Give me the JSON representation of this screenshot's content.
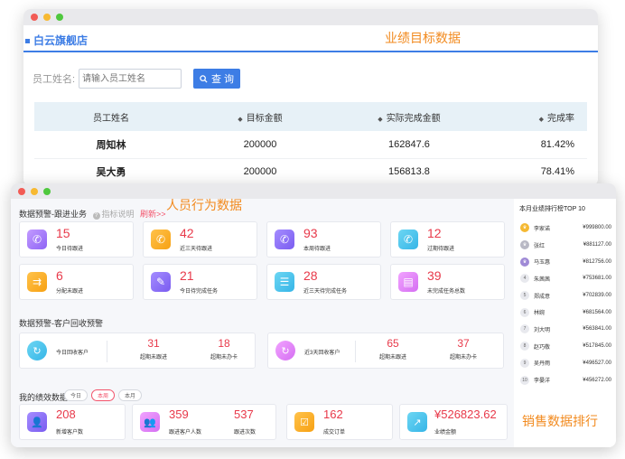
{
  "window1": {
    "store_name": "白云旗舰店",
    "callout": "业绩目标数据",
    "search": {
      "label": "员工姓名:",
      "placeholder": "请输入员工姓名",
      "button": "查 询"
    },
    "table": {
      "headers": [
        "员工姓名",
        "目标金额",
        "实际完成金额",
        "完成率"
      ],
      "rows": [
        {
          "name": "周知林",
          "target": "200000",
          "actual": "162847.6",
          "rate": "81.42%"
        },
        {
          "name": "吴大勇",
          "target": "200000",
          "actual": "156813.8",
          "rate": "78.41%"
        }
      ]
    }
  },
  "window2": {
    "callout_behavior": "人员行为数据",
    "callout_sales": "销售数据排行",
    "followup": {
      "title": "数据预警-跟进业务",
      "hint": "指标说明",
      "link": "刷新>>",
      "cards": [
        {
          "value": "15",
          "label": "今日待跟进",
          "icon": "phone-icon",
          "color": "purple"
        },
        {
          "value": "42",
          "label": "近三天待跟进",
          "icon": "phone-icon",
          "color": "orange"
        },
        {
          "value": "93",
          "label": "本周待跟进",
          "icon": "phone-icon",
          "color": "violet"
        },
        {
          "value": "12",
          "label": "过期待跟进",
          "icon": "phone-icon",
          "color": "cyan"
        },
        {
          "value": "6",
          "label": "分配未跟进",
          "icon": "assign-icon",
          "color": "orange"
        },
        {
          "value": "21",
          "label": "今日待完成任务",
          "icon": "task-icon",
          "color": "violet"
        },
        {
          "value": "28",
          "label": "近三天待完成任务",
          "icon": "task-icon",
          "color": "cyan"
        },
        {
          "value": "39",
          "label": "未完成任务总数",
          "icon": "task-icon",
          "color": "pink"
        }
      ]
    },
    "recycle": {
      "title": "数据预警-客户回收预警",
      "groups": [
        {
          "label": "今日回收客户",
          "color": "cyan",
          "stats": [
            {
              "value": "31",
              "label": "超期未跟进"
            },
            {
              "value": "18",
              "label": "超期未办卡"
            }
          ]
        },
        {
          "label": "近3天回收客户",
          "color": "pink",
          "stats": [
            {
              "value": "65",
              "label": "超期未跟进"
            },
            {
              "value": "37",
              "label": "超期未办卡"
            }
          ]
        }
      ]
    },
    "performance": {
      "title": "我的绩效数据",
      "tabs": [
        "今日",
        "本周",
        "本月"
      ],
      "active_tab": "本周",
      "items": [
        {
          "value": "208",
          "label": "新增客户数",
          "color": "violet"
        },
        {
          "value": "359",
          "label": "跟进客户人数",
          "value2": "537",
          "label2": "跟进次数",
          "color": "pink"
        },
        {
          "value": "162",
          "label": "成交订单",
          "color": "orange"
        },
        {
          "value": "¥526823.62",
          "label": "业绩金额",
          "color": "cyan"
        }
      ]
    },
    "ranking": {
      "title": "本月业绩排行榜TOP 10",
      "rows": [
        {
          "rank": "1",
          "name": "李家诺",
          "amount": "¥999800.00"
        },
        {
          "rank": "2",
          "name": "张红",
          "amount": "¥881127.00"
        },
        {
          "rank": "3",
          "name": "马玉惠",
          "amount": "¥812756.00"
        },
        {
          "rank": "4",
          "name": "朱茜茜",
          "amount": "¥753681.00"
        },
        {
          "rank": "5",
          "name": "郑成意",
          "amount": "¥702839.00"
        },
        {
          "rank": "6",
          "name": "林婉",
          "amount": "¥681564.00"
        },
        {
          "rank": "7",
          "name": "刘大明",
          "amount": "¥563841.00"
        },
        {
          "rank": "8",
          "name": "赵巧敬",
          "amount": "¥517845.00"
        },
        {
          "rank": "9",
          "name": "吴丹雨",
          "amount": "¥496527.00"
        },
        {
          "rank": "10",
          "name": "李晏洋",
          "amount": "¥456272.00"
        }
      ]
    }
  },
  "colors": {
    "accent": "#3d7de5",
    "danger": "#e8394a",
    "callout": "#f28a1e",
    "link": "#f3536b"
  }
}
